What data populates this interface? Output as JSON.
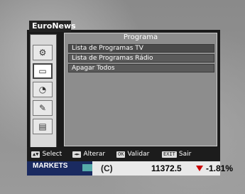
{
  "osd": {
    "title": "EuroNews",
    "content_title": "Programa",
    "items": [
      {
        "label": "Lista de Programas TV"
      },
      {
        "label": "Lista de Programas Rádio"
      },
      {
        "label": "Apagar Todos"
      }
    ],
    "menu_icons": [
      "settings-icon",
      "tv-icon",
      "satellite-icon",
      "tools-icon",
      "media-icon"
    ]
  },
  "help_bar": {
    "select_key": "▲▼",
    "select_label": "Select",
    "alter_key": "◄►",
    "alter_label": "Alterar",
    "ok_key": "OK",
    "ok_label": "Validar",
    "exit_key": "EXIT",
    "exit_label": "Sair"
  },
  "ticker": {
    "label": "MARKETS",
    "code": "(C)",
    "value": "11372.5",
    "change": "-1.81%"
  }
}
